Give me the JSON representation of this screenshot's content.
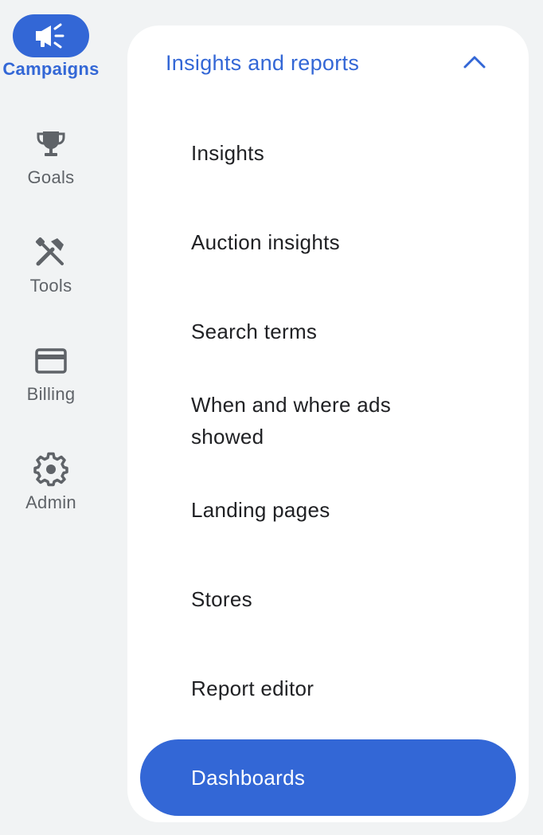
{
  "rail": {
    "items": [
      {
        "label": "Campaigns",
        "icon": "megaphone-icon",
        "active": true
      },
      {
        "label": "Goals",
        "icon": "trophy-icon",
        "active": false
      },
      {
        "label": "Tools",
        "icon": "tools-icon",
        "active": false
      },
      {
        "label": "Billing",
        "icon": "credit-card-icon",
        "active": false
      },
      {
        "label": "Admin",
        "icon": "gear-icon",
        "active": false
      }
    ]
  },
  "panel": {
    "section_title": "Insights and reports",
    "expanded": true,
    "items": [
      {
        "label": "Insights",
        "selected": false
      },
      {
        "label": "Auction insights",
        "selected": false
      },
      {
        "label": "Search terms",
        "selected": false
      },
      {
        "label": "When and where ads showed",
        "selected": false
      },
      {
        "label": "Landing pages",
        "selected": false
      },
      {
        "label": "Stores",
        "selected": false
      },
      {
        "label": "Report editor",
        "selected": false
      },
      {
        "label": "Dashboards",
        "selected": true
      }
    ]
  },
  "colors": {
    "accent": "#3367d6",
    "background": "#f1f3f4",
    "panel": "#ffffff",
    "text": "#202124",
    "muted": "#5f6368"
  }
}
